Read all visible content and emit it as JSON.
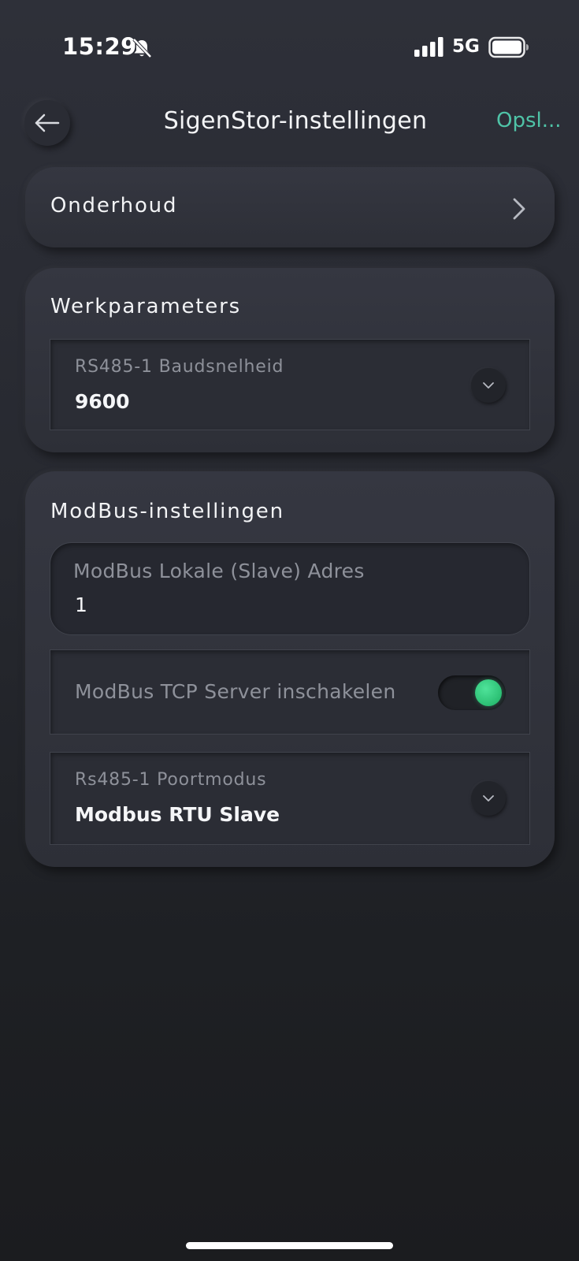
{
  "status_bar": {
    "time": "15:29",
    "network": "5G",
    "icons": [
      "bell-slash-icon",
      "signal-icon",
      "battery-icon"
    ]
  },
  "header": {
    "title": "SigenStor-instellingen",
    "save_label": "Opsl...",
    "back_icon": "arrow-left-icon"
  },
  "maintenance": {
    "title": "Onderhoud"
  },
  "work_parameters": {
    "title": "Werkparameters",
    "baud_label": "RS485-1 Baudsnelheid",
    "baud_value": "9600"
  },
  "modbus": {
    "title": "ModBus-instellingen",
    "slave_label": "ModBus Lokale (Slave) Adres",
    "slave_value": "1",
    "tcp_label": "ModBus TCP Server inschakelen",
    "tcp_enabled": true,
    "port_label": "Rs485-1 Poortmodus",
    "port_value": "Modbus RTU Slave"
  },
  "colors": {
    "accent": "#4fc3a7",
    "toggle_on": "#2bbf73",
    "card_bg": "#31333c",
    "background": "#232529"
  }
}
